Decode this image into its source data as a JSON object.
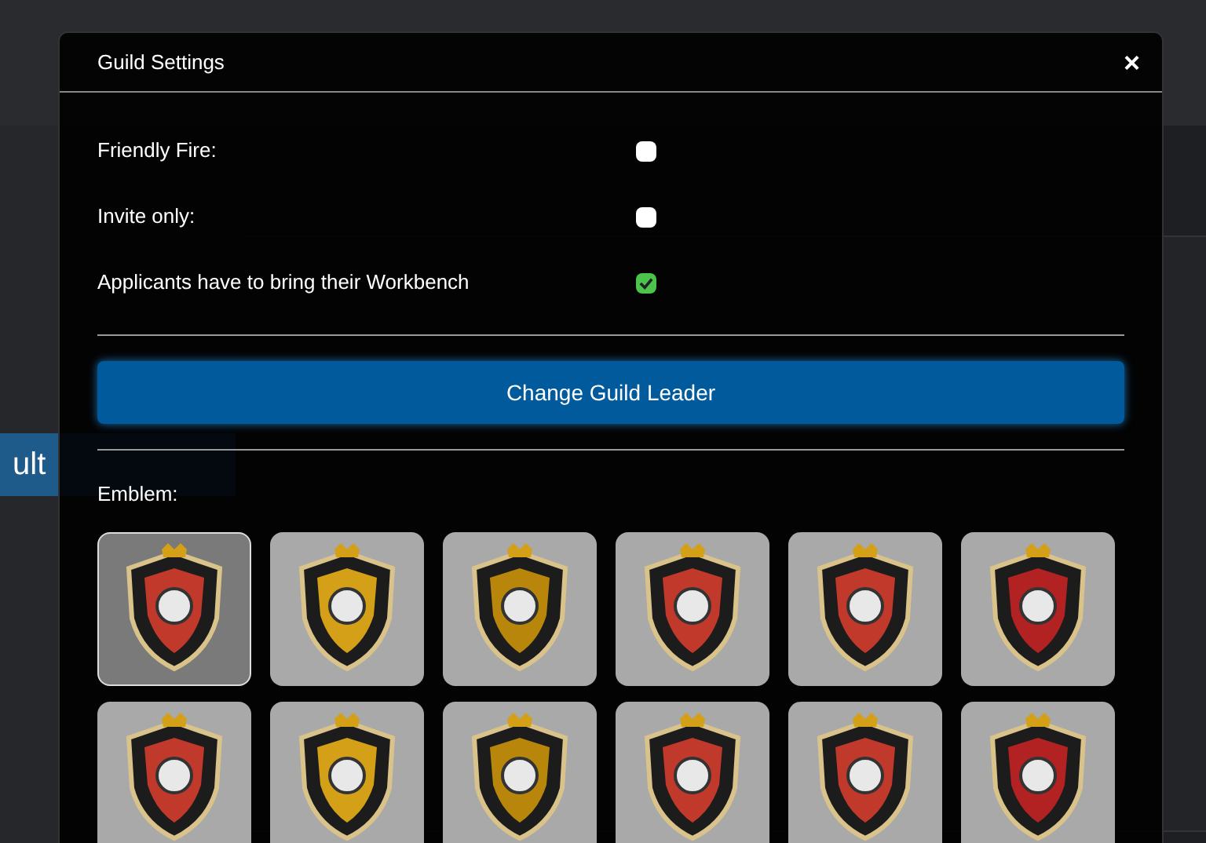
{
  "background": {
    "side_button": "ult"
  },
  "dialog": {
    "title": "Guild Settings",
    "close": "×",
    "options": [
      {
        "label": "Friendly Fire:",
        "checked": false
      },
      {
        "label": "Invite only:",
        "checked": false
      },
      {
        "label": "Applicants have to bring their Workbench",
        "checked": true
      }
    ],
    "leader_button": "Change Guild Leader",
    "emblem_label": "Emblem:",
    "emblems": [
      {
        "selected": true
      },
      {
        "selected": false
      },
      {
        "selected": false
      },
      {
        "selected": false
      },
      {
        "selected": false
      },
      {
        "selected": false
      },
      {
        "selected": false
      },
      {
        "selected": false
      },
      {
        "selected": false
      },
      {
        "selected": false
      },
      {
        "selected": false
      },
      {
        "selected": false
      }
    ]
  }
}
